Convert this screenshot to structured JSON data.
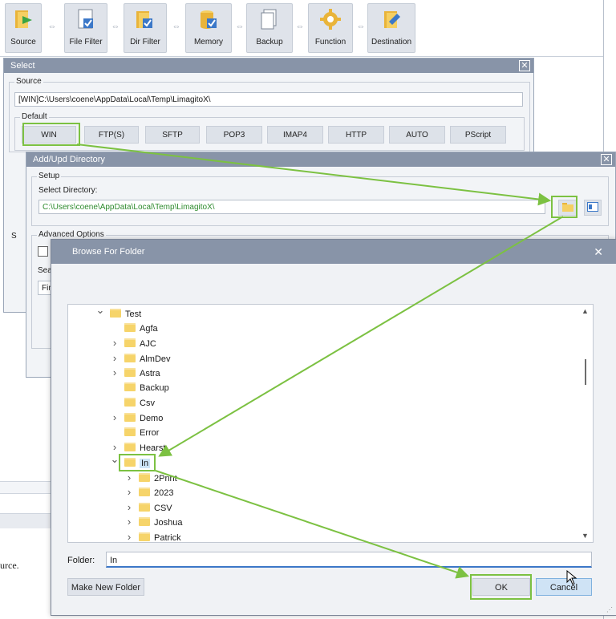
{
  "toolbar": {
    "buttons": [
      {
        "label": "Source",
        "icon": "source-icon"
      },
      {
        "label": "File Filter",
        "icon": "file-filter-icon"
      },
      {
        "label": "Dir Filter",
        "icon": "dir-filter-icon"
      },
      {
        "label": "Memory",
        "icon": "memory-icon"
      },
      {
        "label": "Backup",
        "icon": "backup-icon"
      },
      {
        "label": "Function",
        "icon": "function-icon"
      },
      {
        "label": "Destination",
        "icon": "destination-icon"
      }
    ]
  },
  "background": {
    "trailing_text": "urce."
  },
  "select_dialog": {
    "title": "Select",
    "source_group": "Source",
    "source_value": "[WIN]C:\\Users\\coene\\AppData\\Local\\Temp\\LimagitoX\\",
    "default_group": "Default",
    "protocols": [
      "WIN",
      "FTP(S)",
      "SFTP",
      "POP3",
      "IMAP4",
      "HTTP",
      "AUTO",
      "PScript"
    ],
    "partial_labels": {
      "s": "S",
      "sea": "Sea",
      "fin": "Fin"
    }
  },
  "add_dialog": {
    "title": "Add/Upd Directory",
    "setup_group": "Setup",
    "select_directory_label": "Select Directory:",
    "directory_value": "C:\\Users\\coene\\AppData\\Local\\Temp\\LimagitoX\\",
    "advanced_group": "Advanced Options"
  },
  "browse_dialog": {
    "title": "Browse For Folder",
    "close": "✕",
    "tree": [
      {
        "label": "Test",
        "level": 0,
        "chevron": "down"
      },
      {
        "label": "Agfa",
        "level": 1,
        "chevron": ""
      },
      {
        "label": "AJC",
        "level": 1,
        "chevron": "right"
      },
      {
        "label": "AlmDev",
        "level": 1,
        "chevron": "right"
      },
      {
        "label": "Astra",
        "level": 1,
        "chevron": "right"
      },
      {
        "label": "Backup",
        "level": 1,
        "chevron": ""
      },
      {
        "label": "Csv",
        "level": 1,
        "chevron": ""
      },
      {
        "label": "Demo",
        "level": 1,
        "chevron": "right"
      },
      {
        "label": "Error",
        "level": 1,
        "chevron": ""
      },
      {
        "label": "Hearst",
        "level": 1,
        "chevron": "right"
      },
      {
        "label": "In",
        "level": 1,
        "chevron": "down",
        "selected": true
      },
      {
        "label": "2Print",
        "level": 2,
        "chevron": "right"
      },
      {
        "label": "2023",
        "level": 2,
        "chevron": "right"
      },
      {
        "label": "CSV",
        "level": 2,
        "chevron": "right"
      },
      {
        "label": "Joshua",
        "level": 2,
        "chevron": "right"
      },
      {
        "label": "Patrick",
        "level": 2,
        "chevron": "right"
      }
    ],
    "folder_label": "Folder:",
    "folder_value": "In",
    "make_new_folder": "Make New Folder",
    "ok": "OK",
    "cancel": "Cancel"
  },
  "colors": {
    "highlight": "#7cc142",
    "titlebar": "#8894a8",
    "path_green": "#2e8b2e"
  }
}
